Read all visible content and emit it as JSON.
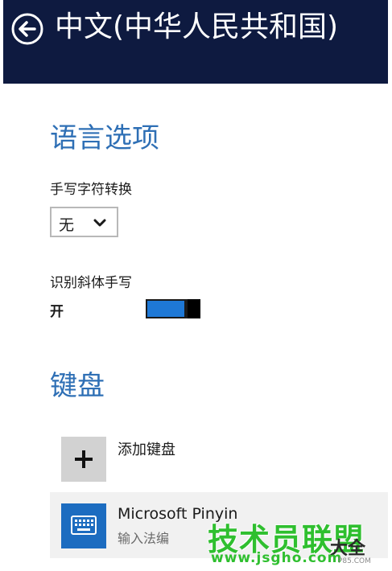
{
  "header": {
    "title": "中文(中华人民共和国)",
    "background": "#0e1a40",
    "back_icon": "back-arrow-circle-icon"
  },
  "language_options": {
    "section_title": "语言选项",
    "handwriting_conversion": {
      "label": "手写字符转换",
      "selected_value": "无"
    },
    "italic_recognition": {
      "label": "识别斜体手写",
      "state_text": "开",
      "on": true
    }
  },
  "keyboard": {
    "section_title": "键盘",
    "add_keyboard_label": "添加键盘",
    "items": [
      {
        "name": "Microsoft Pinyin",
        "subtitle": "输入法编"
      }
    ]
  },
  "watermark": {
    "main": "技术员联盟",
    "side": "大全",
    "url": "www.jsgho.com",
    "small": "P85.COM"
  },
  "colors": {
    "accent": "#2e6fb5",
    "toggle_fill": "#1e78d6",
    "keyboard_tile": "#1c6cc0"
  }
}
